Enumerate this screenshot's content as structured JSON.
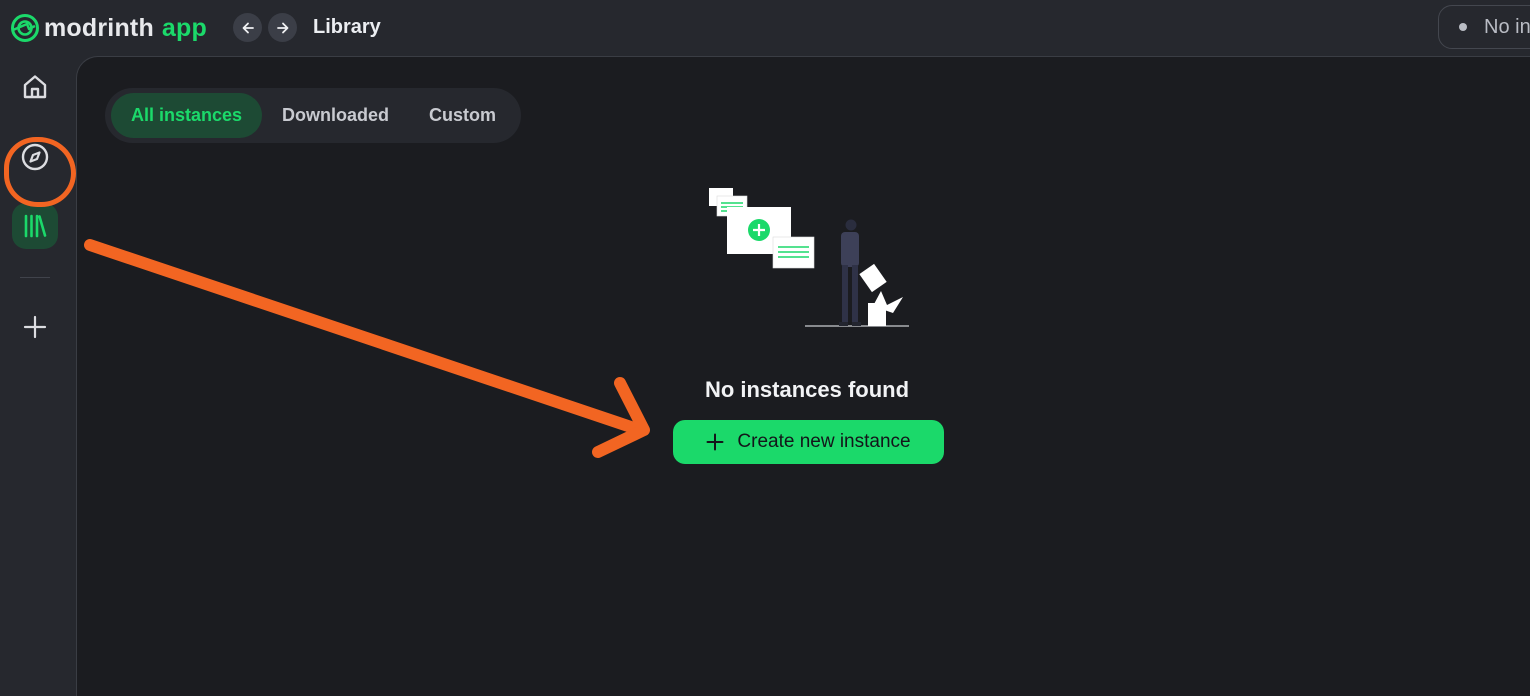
{
  "app": {
    "logo_word": "modrinth",
    "logo_suffix": "app",
    "page_title": "Library",
    "status_text": "No in"
  },
  "icons": {
    "logo": "modrinth-logo-icon",
    "back": "arrow-left-icon",
    "forward": "arrow-right-icon",
    "home": "home-icon",
    "browse": "compass-icon",
    "library": "library-icon",
    "add": "plus-icon"
  },
  "tabs": [
    {
      "label": "All instances",
      "active": true
    },
    {
      "label": "Downloaded",
      "active": false
    },
    {
      "label": "Custom",
      "active": false
    }
  ],
  "empty_state": {
    "title": "No instances found",
    "button_label": "Create new instance"
  },
  "colors": {
    "accent": "#1bd96a",
    "accent_dark": "#1d4a34",
    "annotation": "#f26522",
    "background": "#1b1c20",
    "chrome": "#26282e"
  }
}
